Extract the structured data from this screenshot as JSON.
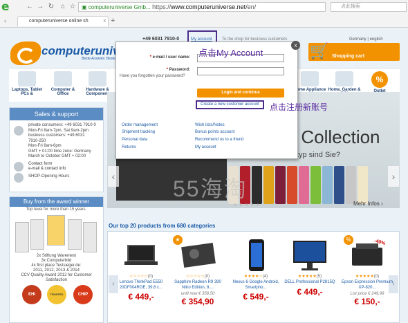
{
  "browser": {
    "url_secure_label": "computeruniverse Gmb...",
    "url_scheme": "https://",
    "url_host": "www.computeruniverse.net",
    "url_path": "/en/",
    "search_placeholder": "点此搜索",
    "tab_title": "computeruniverse online sh",
    "tab_close": "x",
    "new_tab": "+"
  },
  "header": {
    "phone": "+49 6031 7910-0",
    "my_account": "My account",
    "business_link": "To the shop for business customers",
    "language": "Germany | english",
    "brand_name": "computeruniver",
    "brand_tagline": "Beste Auswahl. Bester S",
    "cart_label": "Shopping cart"
  },
  "categories": [
    {
      "label": "Laptops, Tablet PCs &",
      "icon": "laptop-icon"
    },
    {
      "label": "Computer & Office",
      "icon": "computer-icon"
    },
    {
      "label": "Hardware & Component",
      "icon": "hardware-icon"
    },
    {
      "label": "Home Appliance",
      "icon": "appliance-icon"
    },
    {
      "label": "Home, Garden & DIY",
      "icon": "garden-icon"
    },
    {
      "label": "Outlet",
      "icon": "percent-icon",
      "symbol": "%"
    }
  ],
  "sales": {
    "title": "Sales & support",
    "lines": [
      "private consumers: +49 6031 7910-0",
      "Mon-Fri 8am-7pm, Sat 9am-2pm",
      "business customers: +49 6031",
      "7910-250",
      "Mon-Fri 8am-6pm",
      "GMT + 01:00 time zone: Germany",
      "March to October GMT + 02:00"
    ],
    "contact_lines": [
      "Contact form",
      "e-mail & contact info"
    ],
    "opening_hours": "SHOP-Opening Hours"
  },
  "awards": {
    "title": "Buy from the award winner",
    "subtitle": "Top level for more than 15 years.",
    "lines": [
      "2x Stiftung Warentest",
      "3x Computerbild",
      "4x first place Testsieger.de:",
      "2011, 2012, 2013 & 2014",
      "CCV Quality Award 2012 for Customer",
      "Satisfaction"
    ],
    "seals": [
      "EHI",
      "TRUSTED SHOPS",
      "CHIP"
    ]
  },
  "banner": {
    "title": "ro Collection",
    "subtitle": "etrotyp sind Sie?",
    "more": "Mehr Infos ›",
    "prev": "‹",
    "next": "›",
    "dots": "● ● ● ● ●"
  },
  "top_products": {
    "heading": "Our top 20 products from 680 categories",
    "prev": "‹",
    "next": "›",
    "items": [
      {
        "name": "Lenovo ThinkPad E550 20DF004RGE, 39,6 c...",
        "reviews": "(0)",
        "stars": "☆☆☆☆☆",
        "old": "",
        "price": "€ 449,-",
        "icon": "laptop-product-icon"
      },
      {
        "name": "Sapphire Radeon R9 390 Nitro Edition, 8....",
        "reviews": "(0)",
        "stars": "☆☆☆☆☆",
        "old": "until now € 358,50",
        "price": "€ 354,90",
        "icon": "graphics-card-icon",
        "badge": "★"
      },
      {
        "name": "Nexus 6 Google Android, Smartpho...",
        "reviews": "(4)",
        "stars": "★★★★☆",
        "old": "",
        "price": "€ 549,-",
        "icon": "phone-product-icon"
      },
      {
        "name": "DELL Professional P2815Q",
        "reviews": "(5)",
        "stars": "★★★★★",
        "old": "",
        "price": "€ 449,-",
        "icon": "monitor-product-icon"
      },
      {
        "name": "Epson Expression Premium XP-820...",
        "reviews": "(0)",
        "stars": "★★★★★",
        "old": "List price € 249,99",
        "price": "€ 150,-",
        "icon": "printer-product-icon",
        "badge": "%",
        "discount": "-40%"
      }
    ]
  },
  "login": {
    "close": "x",
    "email_label": "e-mail / user name:",
    "password_label": "Password:",
    "required_mark": "*",
    "forgot": "Have you forgotten your password?",
    "login_button": "Login and continue",
    "create_account": "Create a new customer account",
    "links_left": [
      "Order management",
      "Shipment tracking",
      "Personal data",
      "Returns"
    ],
    "links_right": [
      "Wish lists/Notes",
      "Bonus points account",
      "Recommend us to a friend",
      "My account"
    ]
  },
  "annotations": {
    "click_account": "点击My Account",
    "click_register": "点击注册新账号",
    "watermark": "55海淘"
  },
  "colors": {
    "brand_blue": "#1b5aa5",
    "brand_orange": "#f39200",
    "annotation_purple": "#4b2c8a",
    "price_red": "#cc0000"
  }
}
